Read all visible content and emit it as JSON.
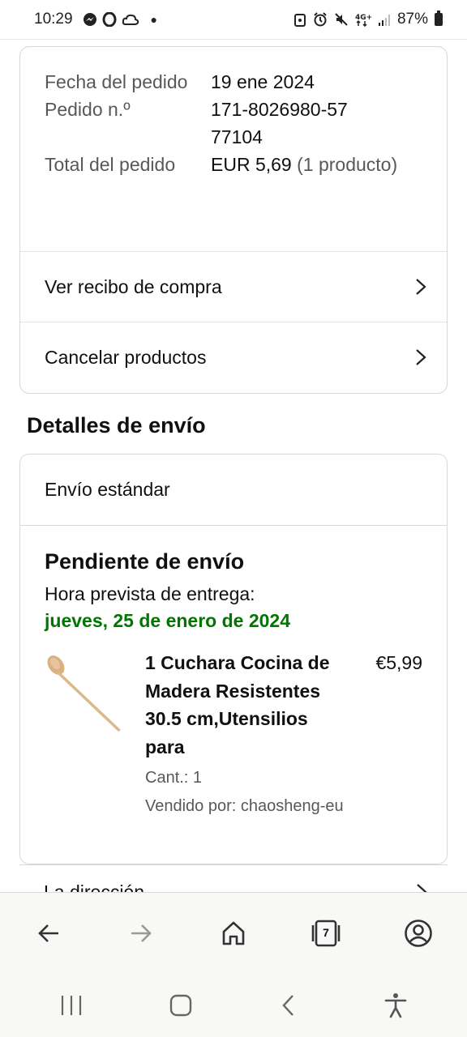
{
  "status_bar": {
    "time": "10:29",
    "battery": "87%",
    "left_icons": [
      "messenger-icon",
      "opera-icon",
      "cloud-icon"
    ],
    "right_icons": [
      "android-icon",
      "alarm-icon",
      "mute-icon",
      "4g-icon",
      "signal-icon",
      "battery-icon"
    ]
  },
  "order_summary": {
    "date_label": "Fecha del pedido",
    "date_value": "19 ene 2024",
    "number_label": "Pedido n.º",
    "number_value": "171-8026980-5777104",
    "total_label": "Total del pedido",
    "total_value": "EUR 5,69",
    "total_count": "(1 producto)",
    "actions": [
      {
        "label": "Ver recibo de compra"
      },
      {
        "label": "Cancelar productos"
      }
    ]
  },
  "shipping": {
    "section_title": "Detalles de envío",
    "method": "Envío estándar",
    "status": "Pendiente de envío",
    "eta_label": "Hora prevista de entrega:",
    "eta_date": "jueves, 25 de enero de 2024",
    "product": {
      "title": "1 Cuchara Cocina de Madera Resistentes 30.5 cm,Utensilios para",
      "price": "€5,99",
      "quantity": "Cant.: 1",
      "seller": "Vendido por: chaosheng-eu"
    }
  },
  "peek_row": {
    "label": "La dirección"
  },
  "browser_bar": {
    "tab_count": "7",
    "buttons": [
      "back-icon",
      "forward-icon",
      "home-icon",
      "tabs-icon",
      "account-icon"
    ]
  },
  "colors": {
    "accent_green": "#007600",
    "text_primary": "#0f1111",
    "text_secondary": "#565959",
    "border": "#d5d9d9"
  }
}
